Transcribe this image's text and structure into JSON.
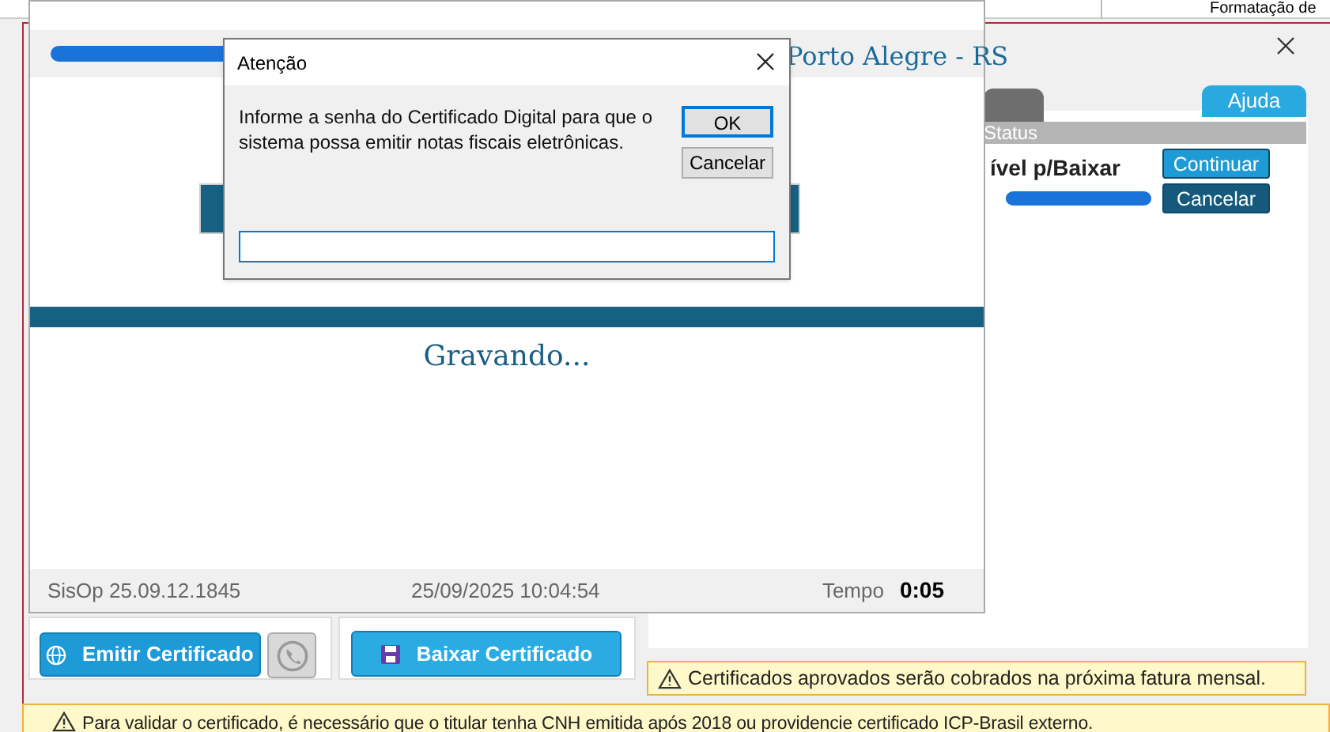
{
  "background_app": {
    "header_text": "Formatação de"
  },
  "main_window": {
    "tabs": [
      {
        "label": "Ajuda"
      }
    ],
    "status_panel": {
      "header": "Status",
      "status_text": "ível p/Baixar",
      "buttons": [
        "Continuar",
        "Cancelar"
      ]
    },
    "action_buttons": [
      {
        "kind": "emit",
        "label": "Emitir Certificado"
      },
      {
        "kind": "download",
        "label": "Baixar Certificado"
      }
    ],
    "notice": "Certificados aprovados serão cobrados na próxima fatura mensal.",
    "banner": "Para validar o certificado, é necessário que o titular tenha CNH emitida após 2018 ou providencie certificado ICP-Brasil externo."
  },
  "progress_window": {
    "location": "Porto Alegre - RS",
    "status": "Gravando...",
    "version": "SisOp 25.09.12.1845",
    "datetime": "25/09/2025 10:04:54",
    "time_label": "Tempo",
    "time_value": "0:05"
  },
  "dialog": {
    "title": "Atenção",
    "message": "Informe a senha do Certificado Digital para que o sistema possa emitir notas fiscais eletrônicas.",
    "buttons": [
      {
        "label": "OK",
        "default": true
      },
      {
        "label": "Cancelar",
        "default": false
      }
    ]
  }
}
